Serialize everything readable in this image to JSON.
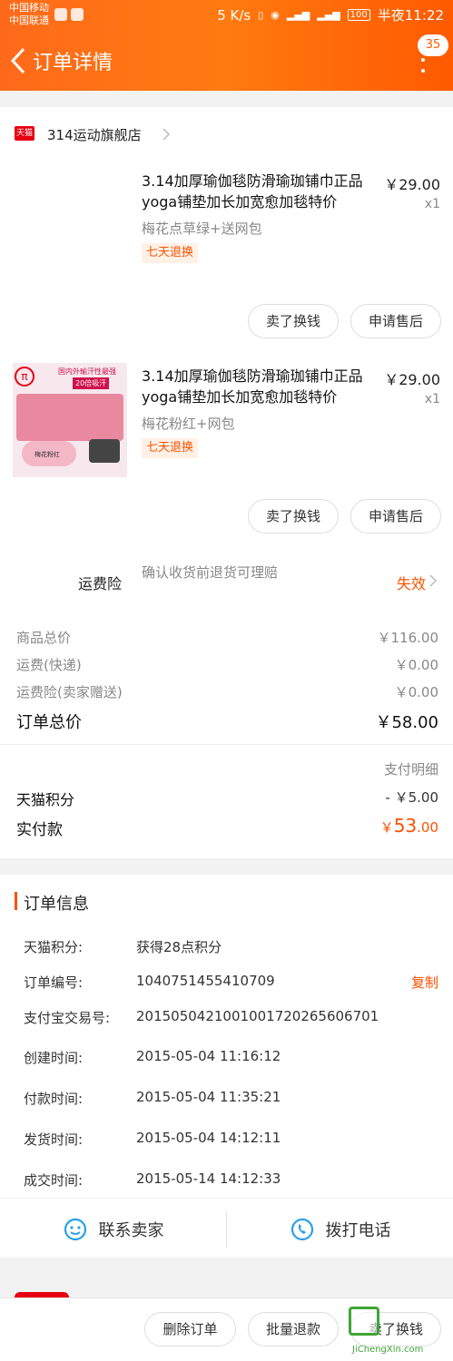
{
  "status_bar": {
    "carrier1": "中国移动",
    "carrier2": "中国联通",
    "speed": "5 K/s",
    "battery": "100",
    "time": "半夜11:22"
  },
  "header": {
    "title": "订单详情",
    "badge": "35"
  },
  "store": {
    "logo": "天猫",
    "name": "314运动旗舰店"
  },
  "products": [
    {
      "title": "3.14加厚瑜伽毯防滑瑜珈铺巾正品yoga铺垫加长加宽愈加毯特价",
      "price": "￥29.00",
      "qty": "x1",
      "sku": "梅花点草绿+送网包",
      "tag": "七天退换",
      "btn_sell": "卖了换钱",
      "btn_after": "申请售后"
    },
    {
      "title": "3.14加厚瑜伽毯防滑瑜珈铺巾正品yoga铺垫加长加宽愈加毯特价",
      "price": "￥29.00",
      "qty": "x1",
      "sku": "梅花粉红+网包",
      "tag": "七天退换",
      "btn_sell": "卖了换钱",
      "btn_after": "申请售后",
      "thumb_banner": "国内外瑜汗性最强",
      "thumb_badge": "20倍吸汗",
      "thumb_caption": "梅花粉红"
    }
  ],
  "insurance": {
    "label": "运费险",
    "desc": "确认收货前退货可理赔",
    "status": "失效"
  },
  "summary": {
    "goods_label": "商品总价",
    "goods_val": "￥116.00",
    "ship_label": "运费(快递)",
    "ship_val": "￥0.00",
    "ins_label": "运费险(卖家赠送)",
    "ins_val": "￥0.00",
    "total_label": "订单总价",
    "total_val": "￥58.00",
    "pay_detail": "支付明细",
    "points_label": "天猫积分",
    "points_val": "- ￥5.00",
    "paid_label": "实付款",
    "paid_currency": "￥",
    "paid_int": "53",
    "paid_dec": ".00"
  },
  "order_info": {
    "title": "订单信息",
    "rows": [
      {
        "label": "天猫积分:",
        "value": "获得28点积分"
      },
      {
        "label": "订单编号:",
        "value": "1040751455410709"
      },
      {
        "label": "支付宝交易号:",
        "value": "2015050421001001720265606701"
      },
      {
        "label": "创建时间:",
        "value": "2015-05-04 11:16:12"
      },
      {
        "label": "付款时间:",
        "value": "2015-05-04 11:35:21"
      },
      {
        "label": "发货时间:",
        "value": "2015-05-04 14:12:11"
      },
      {
        "label": "成交时间:",
        "value": "2015-05-14 14:12:33"
      }
    ],
    "copy": "复制"
  },
  "contact": {
    "seller": "联系卖家",
    "phone": "拨打电话"
  },
  "bottom": {
    "delete": "删除订单",
    "bulk_refund": "批量退款",
    "sell": "卖了换钱"
  },
  "watermark": {
    "site": "JiChengXin.com"
  },
  "colors": {
    "accent": "#ff5000",
    "header_from": "#ff6a1a",
    "header_to": "#ff5a00",
    "tmall_red": "#e60012"
  }
}
